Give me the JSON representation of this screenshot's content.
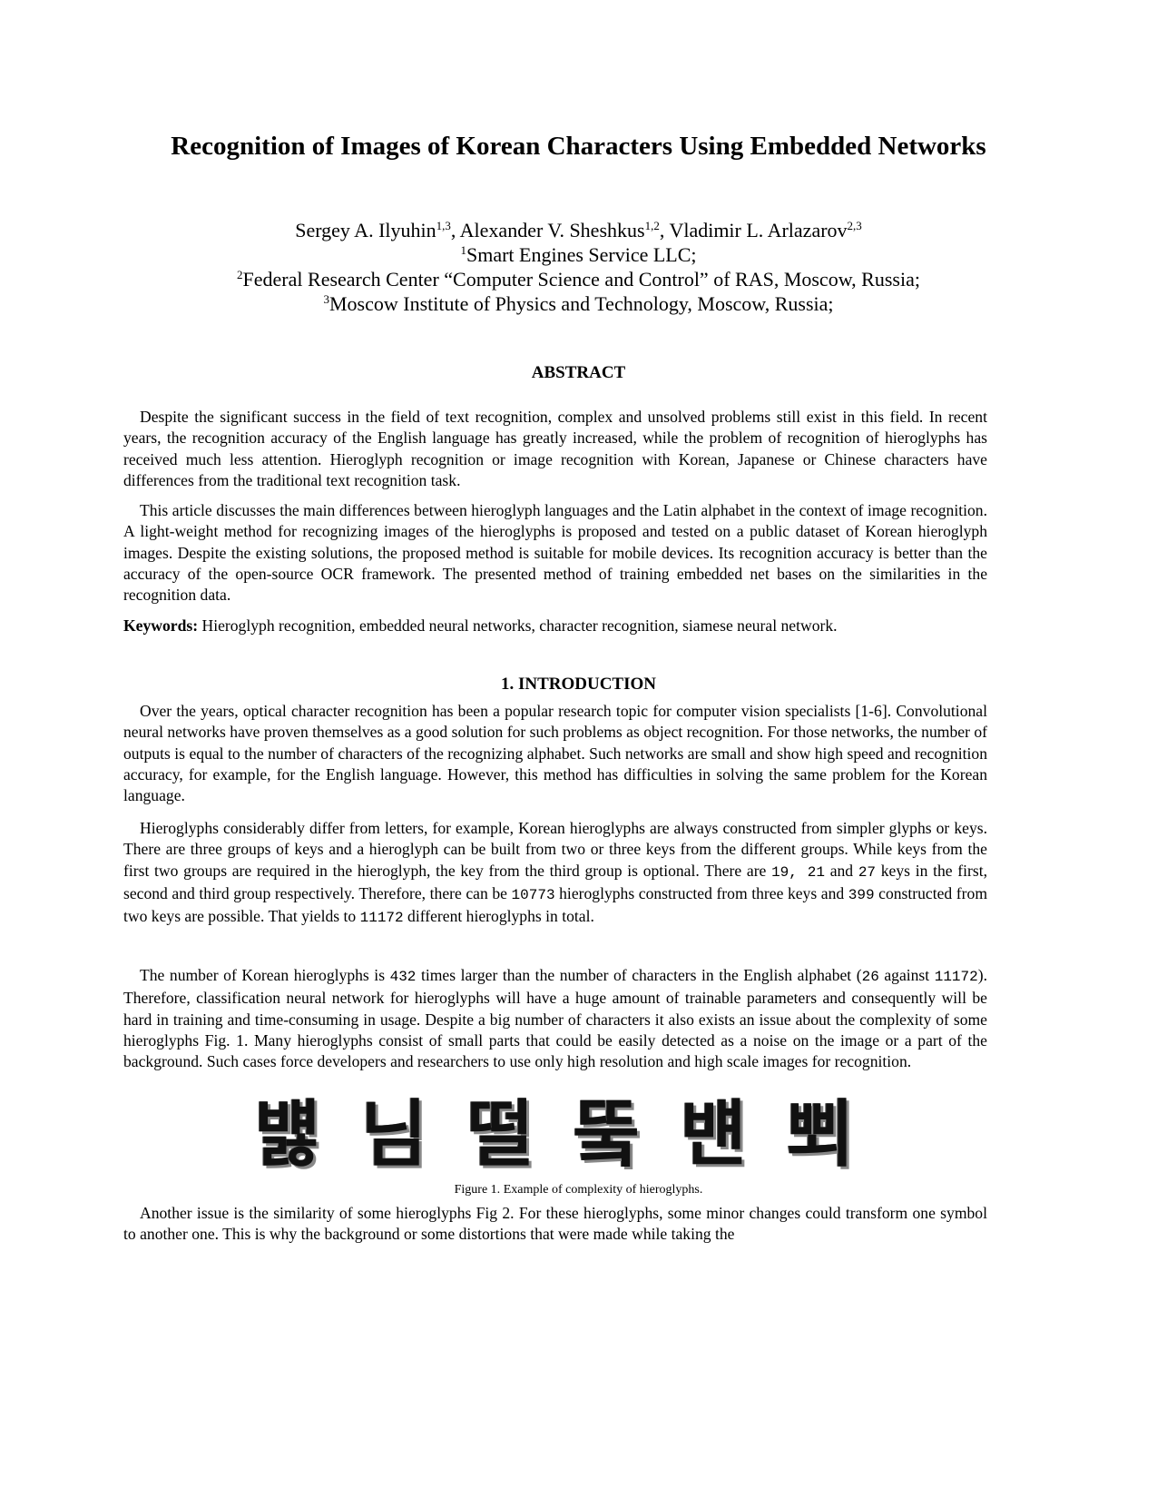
{
  "paper": {
    "title": "Recognition of Images of Korean Characters Using Embedded Networks",
    "authors": [
      {
        "name": "Sergey A. Ilyuhin",
        "affil": "1,3"
      },
      {
        "name": "Alexander V. Sheshkus",
        "affil": "1,2"
      },
      {
        "name": "Vladimir L. Arlazarov",
        "affil": "2,3"
      }
    ],
    "affiliations": [
      {
        "num": "1",
        "text": "Smart Engines Service LLC;"
      },
      {
        "num": "2",
        "text": "Federal Research Center “Computer Science and Control” of RAS, Moscow, Russia;"
      },
      {
        "num": "3",
        "text": "Moscow Institute of Physics and Technology, Moscow, Russia;"
      }
    ],
    "abstract": {
      "heading": "ABSTRACT",
      "paragraphs": [
        "Despite the significant success in the field of text recognition, complex and unsolved problems still exist in this field. In recent years, the recognition accuracy of the English language has greatly increased, while the problem of recognition of hieroglyphs has received much less attention. Hieroglyph recognition or image recognition with Korean, Japanese or Chinese characters have differences from the traditional text recognition task.",
        "This article discusses the main differences between hieroglyph languages and the Latin alphabet in the context of image recognition. A light-weight method for recognizing images of the hieroglyphs is proposed and tested on a public dataset of Korean hieroglyph images. Despite the existing solutions, the proposed method is suitable for mobile devices. Its recognition accuracy is better than the accuracy of the open-source OCR framework. The presented method of training embedded net bases on the similarities in the recognition data."
      ],
      "keywords_label": "Keywords:",
      "keywords": " Hieroglyph recognition, embedded neural networks, character recognition, siamese neural network."
    },
    "introduction": {
      "heading": "1. INTRODUCTION",
      "p1": "Over the years, optical character recognition has been a popular research topic for computer vision specialists [1-6]. Convolutional neural networks have proven themselves as a good solution for such problems as object recognition. For those networks, the number of outputs is equal to the number of characters of the recognizing alphabet. Such networks are small and show high speed and recognition accuracy, for example, for the English language. However, this method has difficulties in solving the same problem for the Korean language.",
      "p2": {
        "a": "Hieroglyphs considerably differ from letters, for example, Korean hieroglyphs are always constructed from simpler glyphs or keys. There are three groups of keys and a hieroglyph can be built from two or three keys from the different groups. While keys from the first two groups are required in the hieroglyph, the key from the third group is optional. There are ",
        "n1": "19, 21",
        "b": " and ",
        "n2": "27",
        "c": " keys in the first, second and third group respectively. Therefore, there can be ",
        "n3": "10773",
        "d": " hieroglyphs constructed from three keys and ",
        "n4": "399",
        "e": " constructed from two keys are possible. That yields to ",
        "n5": "11172",
        "f": " different hieroglyphs in total."
      },
      "p3": {
        "a": "The number of Korean hieroglyphs is ",
        "n1": "432",
        "b": " times larger than the number of characters in the English alphabet (",
        "n2": "26",
        "c": " against ",
        "n3": "11172",
        "d": "). Therefore, classification neural network for hieroglyphs will have a huge amount of trainable parameters and consequently will be hard in training and time-consuming in usage. Despite a big number of characters it also exists an issue about the complexity of some hieroglyphs Fig. 1. Many hieroglyphs consist of small parts that could be easily detected as a noise on the image or a part of the background. Such cases force developers and researchers to use only high resolution and high scale images for recognition."
      },
      "figure1": {
        "glyphs": [
          "뱷",
          "님",
          "떨",
          "뚴",
          "뱬",
          "뾔"
        ],
        "caption_label": "Figure 1.",
        "caption_text": " Example of complexity of hieroglyphs."
      },
      "p4": "Another issue is the similarity of some hieroglyphs Fig 2. For these hieroglyphs, some minor changes could transform one symbol to another one. This is why the background or some distortions that were made while taking the"
    }
  }
}
